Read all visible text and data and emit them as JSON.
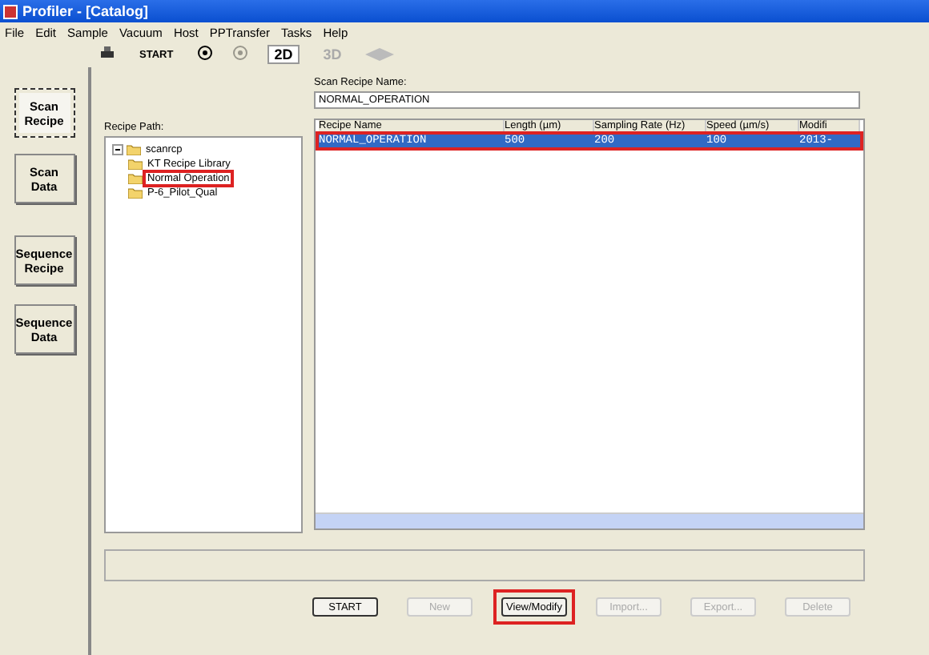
{
  "window": {
    "title": "Profiler - [Catalog]"
  },
  "menu": [
    "File",
    "Edit",
    "Sample",
    "Vacuum",
    "Host",
    "PPTransfer",
    "Tasks",
    "Help"
  ],
  "toolbar": [
    {
      "kind": "printer",
      "disabled": false
    },
    {
      "kind": "text",
      "label": "START",
      "disabled": false
    },
    {
      "kind": "dial",
      "disabled": false
    },
    {
      "kind": "dial",
      "disabled": true
    },
    {
      "kind": "toggle",
      "label": "2D",
      "disabled": false
    },
    {
      "kind": "toggle",
      "label": "3D",
      "disabled": true
    },
    {
      "kind": "arrows",
      "disabled": true
    }
  ],
  "sidebar": [
    {
      "label": "Scan Recipe",
      "selected": true
    },
    {
      "label": "Scan Data",
      "selected": false
    },
    {
      "label": "Sequence Recipe",
      "selected": false
    },
    {
      "label": "Sequence Data",
      "selected": false
    }
  ],
  "recipe_path": {
    "label": "Recipe Path:",
    "tree": [
      {
        "label": "scanrcp",
        "expanded": true,
        "highlighted": false,
        "children": [
          {
            "label": "KT Recipe Library",
            "highlighted": false
          },
          {
            "label": "Normal Operation",
            "highlighted": true
          },
          {
            "label": "P-6_Pilot_Qual",
            "highlighted": false
          }
        ]
      }
    ]
  },
  "recipe_name": {
    "label": "Scan Recipe Name:",
    "value": "NORMAL_OPERATION"
  },
  "table": {
    "columns": [
      "Recipe Name",
      "Length (µm)",
      "Sampling Rate (Hz)",
      "Speed (µm/s)",
      "Modifi"
    ],
    "rows": [
      {
        "cells": [
          "NORMAL_OPERATION",
          "500",
          "200",
          "100",
          "2013-"
        ],
        "selected": true,
        "highlighted": true
      }
    ]
  },
  "buttons": [
    {
      "label": "START",
      "disabled": false,
      "highlighted": false
    },
    {
      "label": "New",
      "disabled": true,
      "highlighted": false
    },
    {
      "label": "View/Modify",
      "disabled": false,
      "highlighted": true
    },
    {
      "label": "Import...",
      "disabled": true,
      "highlighted": false
    },
    {
      "label": "Export...",
      "disabled": true,
      "highlighted": false
    },
    {
      "label": "Delete",
      "disabled": true,
      "highlighted": false
    }
  ]
}
